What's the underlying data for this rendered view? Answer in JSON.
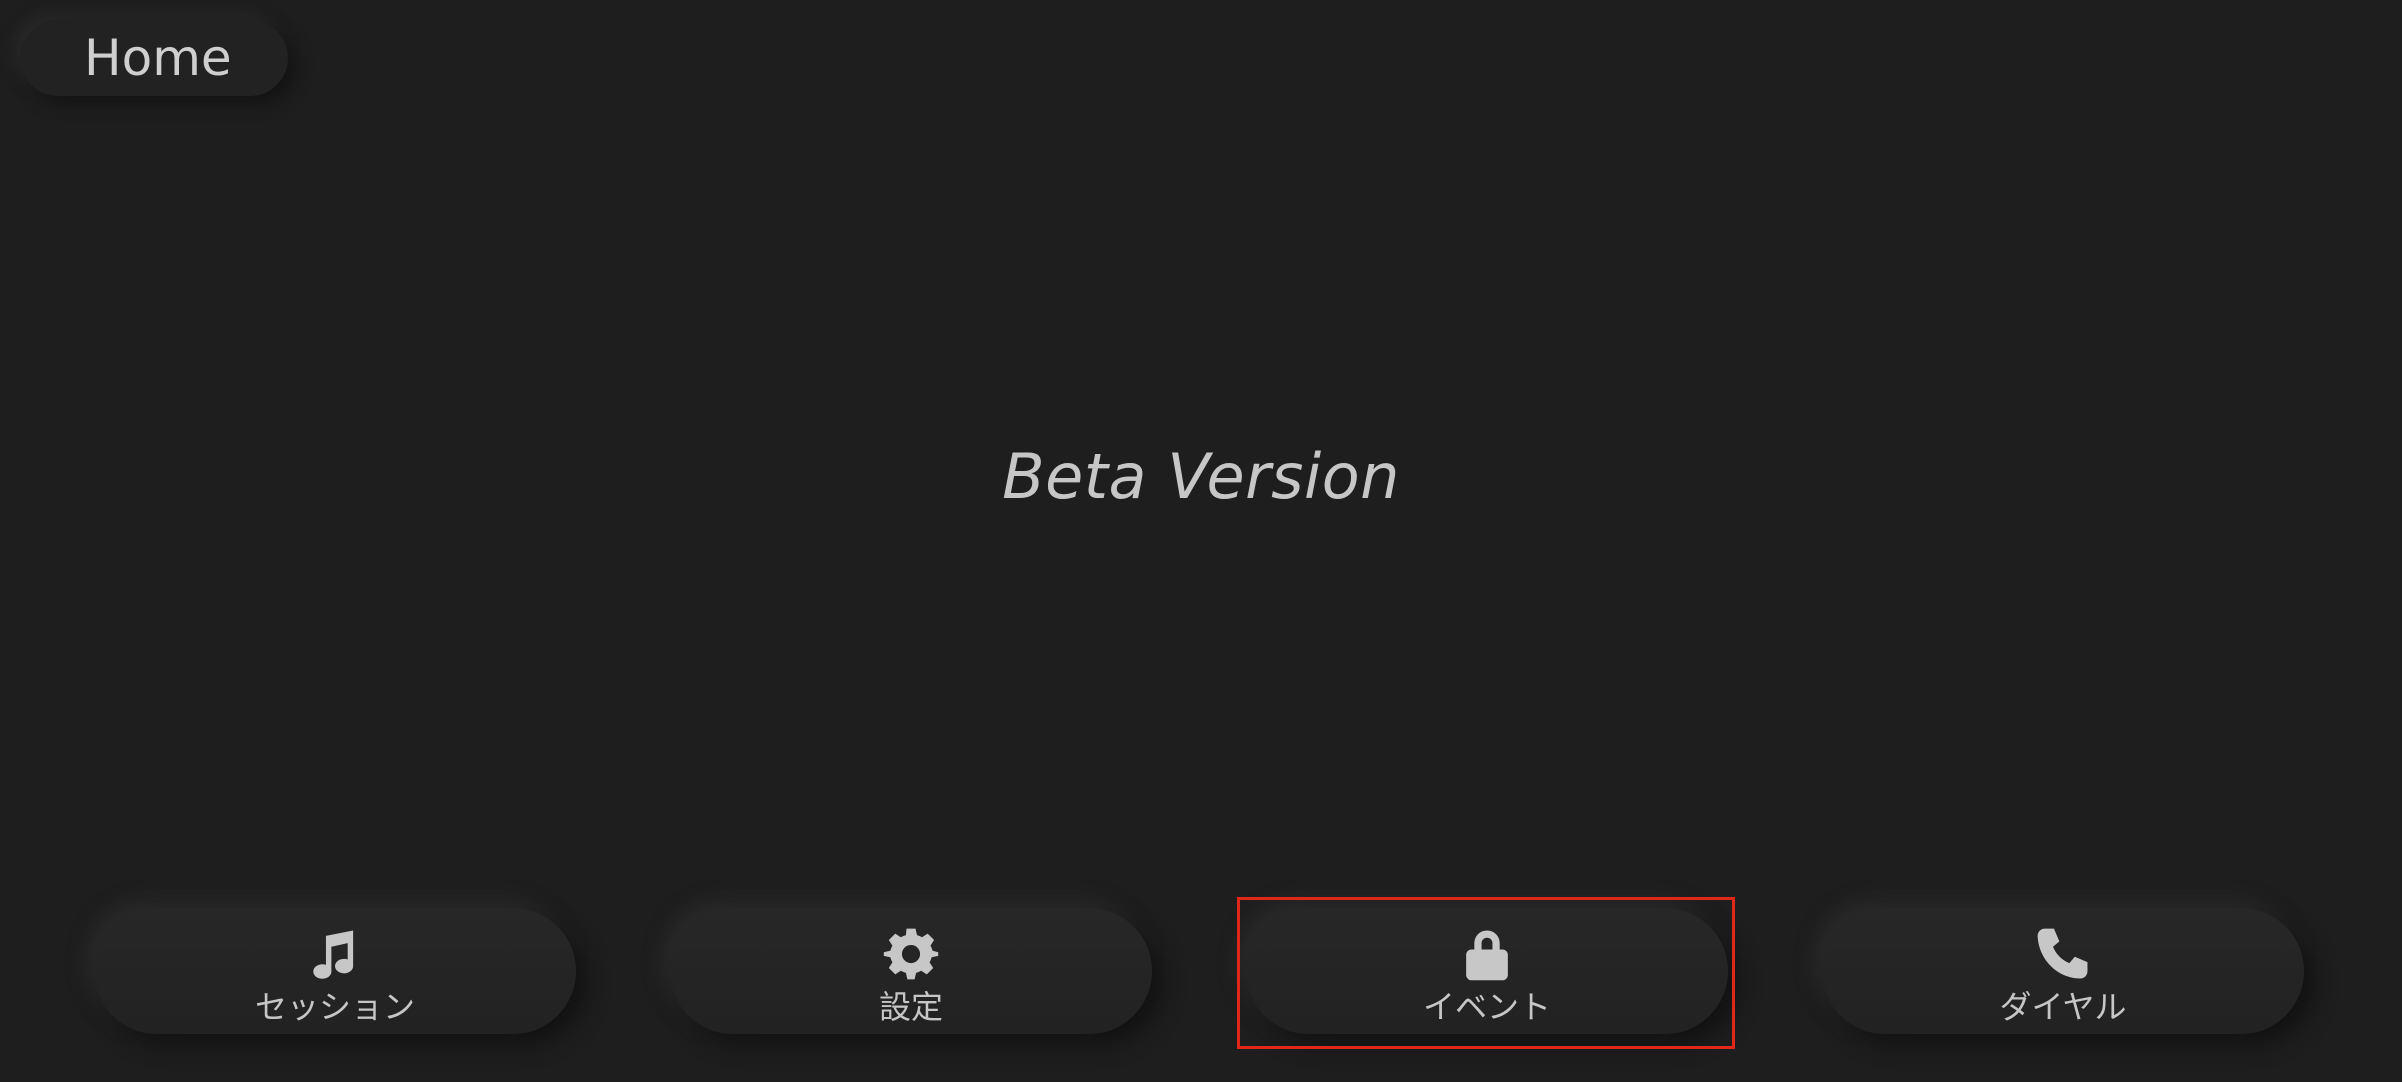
{
  "header": {
    "home_label": "Home"
  },
  "main": {
    "banner_text": "Beta Version"
  },
  "nav": {
    "items": [
      {
        "label": "セッション",
        "icon": "music-note-icon"
      },
      {
        "label": "設定",
        "icon": "gear-icon"
      },
      {
        "label": "イベント",
        "icon": "lock-icon"
      },
      {
        "label": "ダイヤル",
        "icon": "phone-icon"
      }
    ]
  },
  "colors": {
    "background": "#1e1e1e",
    "text": "#c9c9c9",
    "highlight": "#e0271a"
  }
}
